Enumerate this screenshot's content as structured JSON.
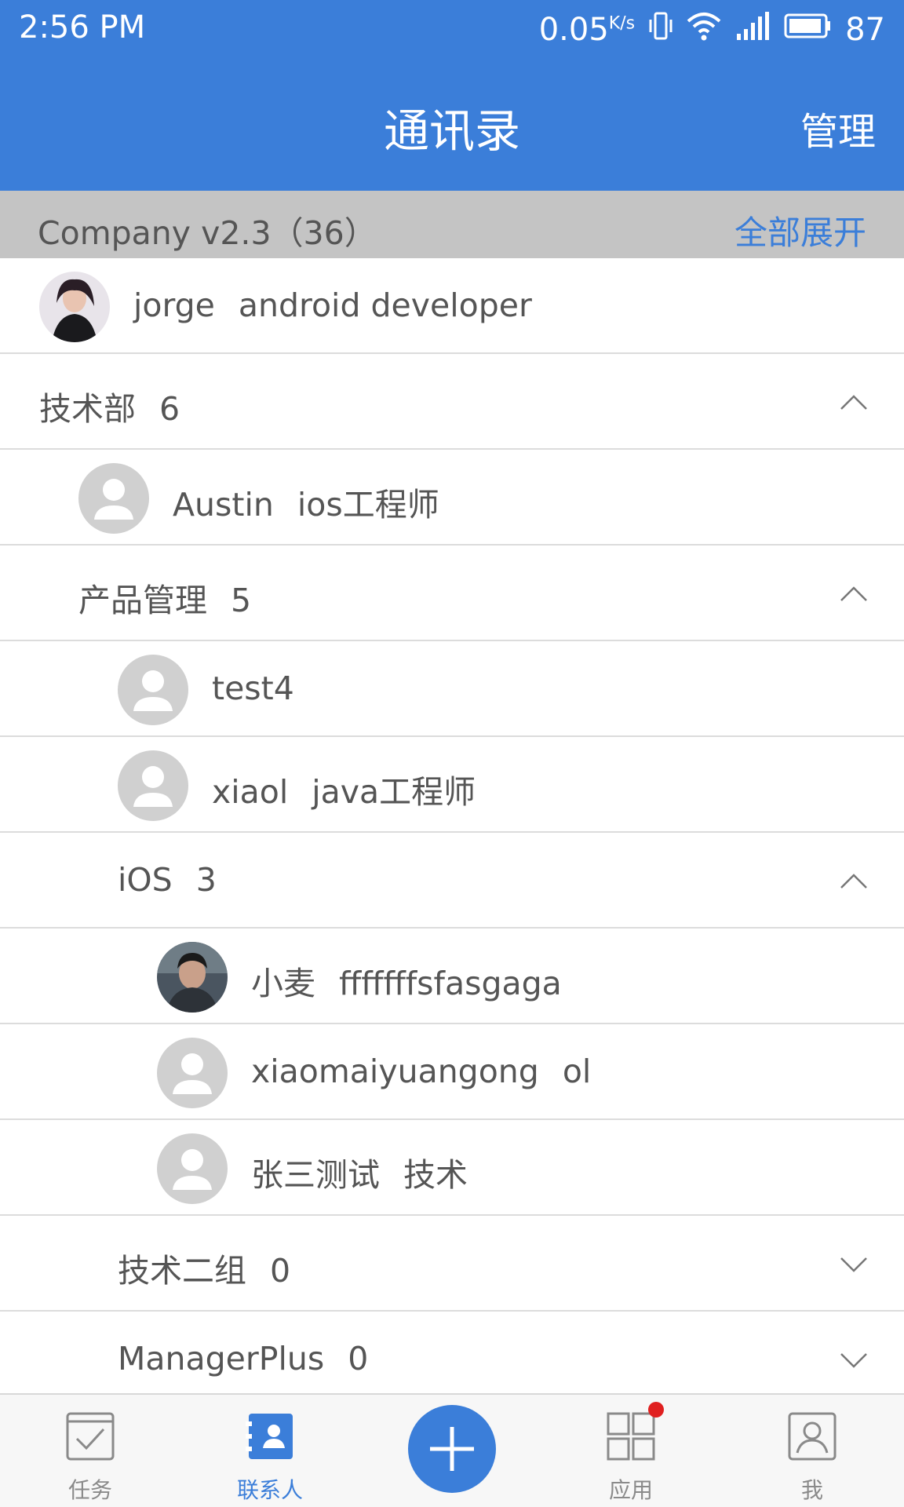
{
  "status_bar": {
    "time": "2:56 PM",
    "speed": "0.05",
    "speed_unit": "K/s",
    "battery": "87"
  },
  "header": {
    "title": "通讯录",
    "manage": "管理"
  },
  "company": {
    "name": "Company v2.3（36）",
    "expand_all": "全部展开"
  },
  "list": [
    {
      "type": "member",
      "name": "jorge",
      "role": "android developer",
      "avatar": "photo"
    },
    {
      "type": "group",
      "name": "技术部",
      "count": "6",
      "expanded": true
    },
    {
      "type": "member",
      "name": "Austin",
      "role": "ios工程师",
      "avatar": "default"
    },
    {
      "type": "group",
      "name": "产品管理",
      "count": "5",
      "expanded": true
    },
    {
      "type": "member",
      "name": "test4",
      "role": "",
      "avatar": "default"
    },
    {
      "type": "member",
      "name": "xiaol",
      "role": "java工程师",
      "avatar": "default"
    },
    {
      "type": "group",
      "name": "iOS",
      "count": "3",
      "expanded": true
    },
    {
      "type": "member",
      "name": "小麦",
      "role": "fffffffsfasgaga",
      "avatar": "photo"
    },
    {
      "type": "member",
      "name": "xiaomaiyuangong",
      "role": "ol",
      "avatar": "default"
    },
    {
      "type": "member",
      "name": "张三测试",
      "role": "技术",
      "avatar": "default"
    },
    {
      "type": "group",
      "name": "技术二组",
      "count": "0",
      "expanded": false
    },
    {
      "type": "group",
      "name": "ManagerPlus",
      "count": "0",
      "expanded": false
    }
  ],
  "bottom_nav": {
    "tasks": "任务",
    "contacts": "联系人",
    "apps": "应用",
    "me": "我"
  },
  "colors": {
    "primary": "#3b7ed9",
    "header_bg": "#c4c4c4",
    "text": "#555555",
    "badge": "#e02020"
  }
}
